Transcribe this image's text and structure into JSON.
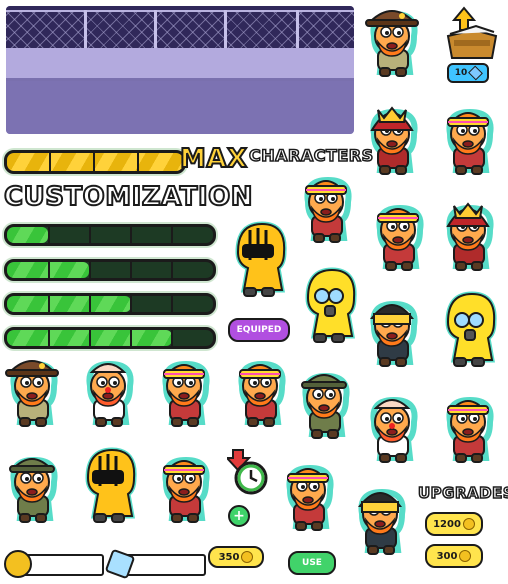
{
  "labels": {
    "max": "MAX",
    "characters": "CHARACTERS",
    "customization": "CUSTOMIZATION",
    "upgrades": "UPGRADES",
    "equiped": "EQUIPED",
    "use": "USE"
  },
  "prices": {
    "gem_chest": "10",
    "upgrade_1": "1200",
    "upgrade_2": "300",
    "item": "350"
  },
  "progress": {
    "max_bar": 1.0,
    "bars": [
      0.2,
      0.4,
      0.6,
      0.8
    ]
  },
  "currency_fields": {
    "coins": "",
    "gems": ""
  },
  "colors": {
    "accent_green": "#3ccc3c",
    "accent_yellow": "#ffd23a",
    "accent_purple": "#b14fe0",
    "outline": "#1b1b1b",
    "glow": "#57dcc8"
  },
  "icons": [
    "treasure-chest-icon",
    "gem-icon",
    "coin-icon",
    "clock-icon",
    "plus-icon",
    "arrow-icon"
  ]
}
